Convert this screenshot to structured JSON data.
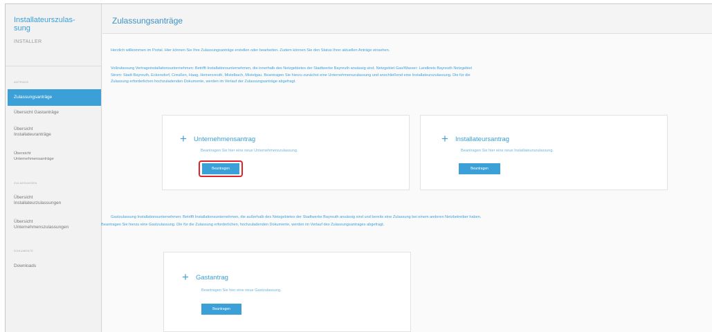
{
  "sidebar": {
    "brand_title_1": "Installateurszulas-",
    "brand_title_2": "sung",
    "brand_sub": "INSTALLER",
    "section_1": "ANTRÄGE",
    "items_1": [
      {
        "label": "Zulassungsanträge",
        "active": true
      },
      {
        "label": "Übersicht Gastanträge"
      },
      {
        "label_1": "Übersicht",
        "label_2": "Installateuranträge"
      },
      {
        "label_1": "Übersicht",
        "label_2": "Unternehmensanträge"
      }
    ],
    "section_2": "ZULASSUNGEN",
    "items_2": [
      {
        "label_1": "Übersicht",
        "label_2": "Installateurzulassungen"
      },
      {
        "label_1": "Übersicht",
        "label_2": "Unternehmenszulassungen"
      }
    ],
    "section_3": "DOKUMENTE",
    "items_3": [
      {
        "label": "Downloads"
      }
    ]
  },
  "header": {
    "title": "Zulassungsanträge"
  },
  "main": {
    "welcome": "Herzlich willkommen im Portal. Hier können Sie Ihre Zulassungsanträge erstellen oder bearbeiten. Zudem können Sie den Status Ihrer aktuellen Anträge einsehen.",
    "vollzulassung_1": "Vollzulassung Vertragsinstallationsunternehmen: Betrifft Installationsunternehmen, die innerhalb des Netzgebietes der Stadtwerke Bayreuth ansässig sind. Netzgebiet Gas/Wasser: Landkreis Bayreuth Netzgebiet",
    "vollzulassung_2": "Strom: Stadt Bayreuth, Eckersdorf, Creußen, Haag, Heinersreuth, Mistelbach, Mistelgau. Beantragen Sie hierzu zunächst eine Unternehmenszulassung und anschließend eine Installateurszulassung. Die für die",
    "vollzulassung_3": "Zulassung erforderlichen hochzuladenden Dokumente, werden im Verlauf der Zulassungsanträge abgefragt.",
    "gast_1": "Gastzulassung Installationsunternehmen: Betrifft Installationsunternehmen, die außerhalb des Netzgebietes der Stadtwerke Bayreuth ansässig sind und bereits eine Zulassung bei einem anderen Netzbetreiber haben.",
    "gast_2": "Beantragen Sie hierzu eine Gastzulassung. Die für die Zulassung erforderlichen, hochzuladenden Dokumente, werden im Verlauf des Zulassungsantrages abgefragt.",
    "cards": {
      "unternehmen": {
        "title": "Unternehmensantrag",
        "desc": "Beantragen Sie hier eine neue Unternehmenszulassung.",
        "button": "Beantragen"
      },
      "installateur": {
        "title": "Installateursantrag",
        "desc": "Beantragen Sie hier eine neue Installateurszulassung.",
        "button": "Beantragen"
      },
      "gast": {
        "title": "Gastantrag",
        "desc": "Beantragen Sie hier eine neue Gastzulassung.",
        "button": "Beantragen"
      }
    },
    "plus_icon": "+"
  },
  "colors": {
    "accent": "#3aa0d7",
    "highlight": "#e0212b"
  }
}
